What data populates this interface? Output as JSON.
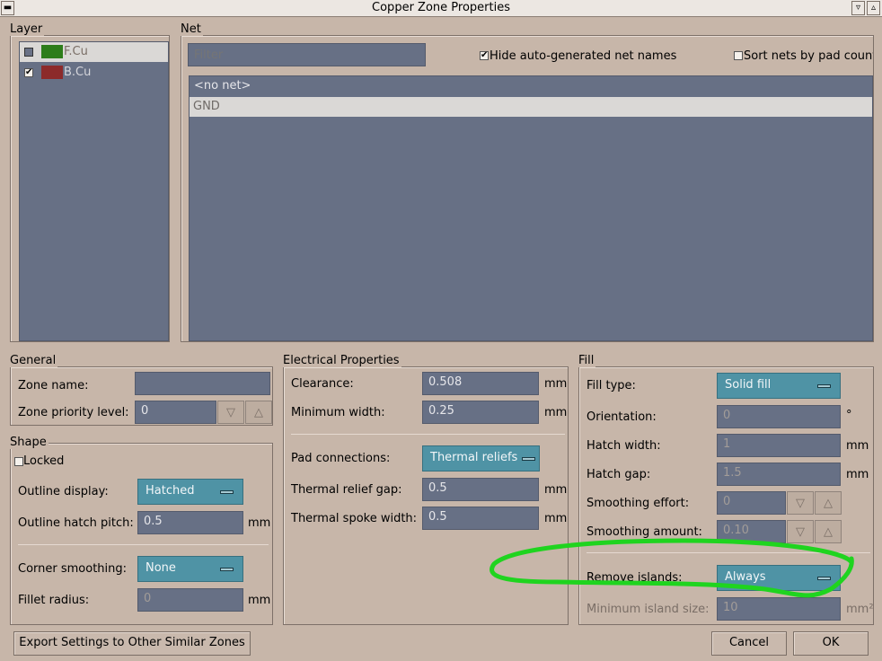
{
  "window": {
    "title": "Copper Zone Properties"
  },
  "layer": {
    "legend": "Layer",
    "items": [
      {
        "name": "F.Cu",
        "checked": false,
        "color": "#2d7d1a"
      },
      {
        "name": "B.Cu",
        "checked": true,
        "color": "#8c2a2a"
      }
    ]
  },
  "net": {
    "legend": "Net",
    "filter_placeholder": "Filter",
    "hide_auto_label": "Hide auto-generated net names",
    "hide_auto_checked": true,
    "sort_label": "Sort nets by pad count",
    "sort_checked": false,
    "items": [
      "<no net>",
      "GND"
    ]
  },
  "general": {
    "legend": "General",
    "zone_name_label": "Zone name:",
    "zone_name_value": "",
    "priority_label": "Zone priority level:",
    "priority_value": "0"
  },
  "shape": {
    "legend": "Shape",
    "locked_label": "Locked",
    "outline_display_label": "Outline display:",
    "outline_display_value": "Hatched",
    "hatch_pitch_label": "Outline hatch pitch:",
    "hatch_pitch_value": "0.5",
    "corner_label": "Corner smoothing:",
    "corner_value": "None",
    "fillet_label": "Fillet radius:",
    "fillet_value": "0",
    "unit": "mm"
  },
  "electrical": {
    "legend": "Electrical Properties",
    "clearance_label": "Clearance:",
    "clearance_value": "0.508",
    "min_width_label": "Minimum width:",
    "min_width_value": "0.25",
    "pad_conn_label": "Pad connections:",
    "pad_conn_value": "Thermal reliefs",
    "relief_gap_label": "Thermal relief gap:",
    "relief_gap_value": "0.5",
    "spoke_label": "Thermal spoke width:",
    "spoke_value": "0.5",
    "unit": "mm"
  },
  "fill": {
    "legend": "Fill",
    "fill_type_label": "Fill type:",
    "fill_type_value": "Solid fill",
    "orientation_label": "Orientation:",
    "orientation_value": "0",
    "orientation_unit": "°",
    "hatch_width_label": "Hatch width:",
    "hatch_width_value": "1",
    "hatch_gap_label": "Hatch gap:",
    "hatch_gap_value": "1.5",
    "smooth_effort_label": "Smoothing effort:",
    "smooth_effort_value": "0",
    "smooth_amount_label": "Smoothing amount:",
    "smooth_amount_value": "0.10",
    "islands_label": "Remove islands:",
    "islands_value": "Always",
    "min_island_label": "Minimum island size:",
    "min_island_value": "10",
    "min_island_unit": "mm²",
    "unit": "mm"
  },
  "footer": {
    "export_label": "Export Settings to Other Similar Zones",
    "cancel_label": "Cancel",
    "ok_label": "OK"
  },
  "annotation": {
    "color": "#1fd41f"
  }
}
